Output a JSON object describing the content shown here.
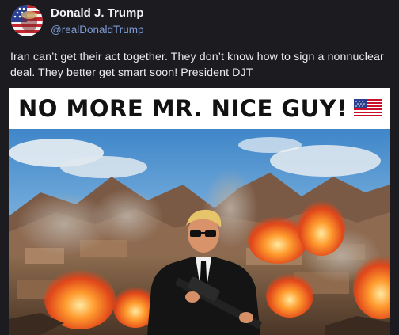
{
  "author": {
    "display_name": "Donald J. Trump",
    "handle": "@realDonaldTrump",
    "avatar_icon": "flag-face-avatar-icon"
  },
  "post": {
    "text": "Iran can’t get their act together. They don’t know how to sign a nonnuclear deal. They better get smart soon! President DJT"
  },
  "media": {
    "headline": "NO MORE MR. NICE GUY!",
    "headline_icon": "us-flag-icon"
  },
  "colors": {
    "background": "#1b1b20",
    "handle": "#7d9bd6",
    "text": "#ececf0",
    "headline": "#121212"
  }
}
